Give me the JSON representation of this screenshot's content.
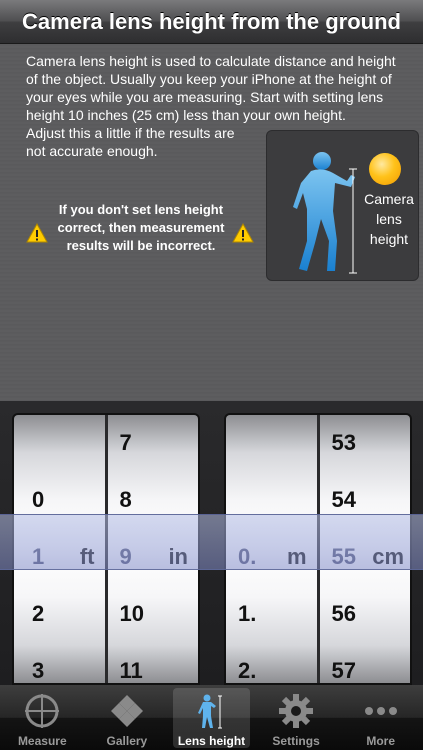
{
  "header": {
    "title": "Camera lens height from the ground"
  },
  "info": {
    "description_1": "Camera lens height is used to calculate distance and height of the object. Usually you keep your iPhone at the height of your eyes while you are measuring. Start with setting lens height 10 inches (25 cm) less than your own height.",
    "description_2": "Adjust this a little if the results are not accurate enough.",
    "warning": "If you don't set lens height correct, then measurement results will be incorrect.",
    "figure_label": "Camera lens height"
  },
  "picker_imperial": {
    "feet": [
      "0",
      "1",
      "2",
      "3"
    ],
    "feet_unit": "ft",
    "inches": [
      "7",
      "8",
      "9",
      "10",
      "11"
    ],
    "inches_unit": "in"
  },
  "picker_metric": {
    "meters": [
      "0.",
      "1.",
      "2."
    ],
    "meters_unit": "m",
    "centimeters": [
      "53",
      "54",
      "55",
      "56",
      "57"
    ],
    "centimeters_unit": "cm"
  },
  "tabs": [
    {
      "label": "Measure",
      "icon": "crosshair-icon"
    },
    {
      "label": "Gallery",
      "icon": "gallery-icon"
    },
    {
      "label": "Lens height",
      "icon": "lens-height-icon",
      "active": true
    },
    {
      "label": "Settings",
      "icon": "gear-icon"
    },
    {
      "label": "More",
      "icon": "more-icon"
    }
  ],
  "colors": {
    "accent_sun": "#ffc21a",
    "figure": "#4aa8e8"
  }
}
